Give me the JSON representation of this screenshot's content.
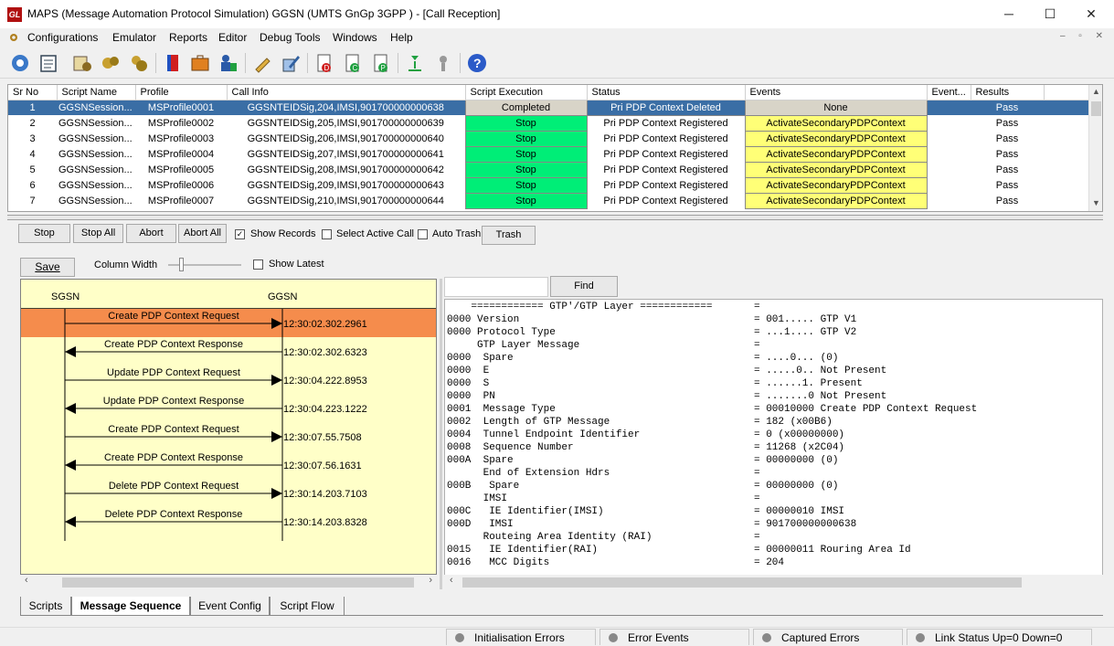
{
  "window": {
    "app_icon": "GL",
    "title": "MAPS (Message Automation Protocol Simulation) GGSN (UMTS GnGp 3GPP ) - [Call Reception]",
    "minimize": "─",
    "maximize": "☐",
    "close": "✕"
  },
  "menu": [
    "Configurations",
    "Emulator",
    "Reports",
    "Editor",
    "Debug Tools",
    "Windows",
    "Help"
  ],
  "toolbar_icons": [
    "settings-gear-icon",
    "notebook-icon",
    "profile-editor-icon",
    "script-tools-icon",
    "script-tools-2-icon",
    "phone-book-icon",
    "briefcase-icon",
    "user-db-icon",
    "pencil-icon",
    "batch-edit-icon",
    "doc-d-icon",
    "doc-c-icon",
    "doc-p-icon",
    "load-icon",
    "tools-icon",
    "help-icon"
  ],
  "grid": {
    "columns": [
      "Sr No",
      "Script Name",
      "Profile",
      "Call Info",
      "Script Execution",
      "Status",
      "Events",
      "Event...",
      "Results"
    ],
    "rows": [
      {
        "sr": "1",
        "script": "GGSNSession...",
        "profile": "MSProfile0001",
        "call_info": "GGSNTEIDSig,204,IMSI,901700000000638",
        "execution": "Completed",
        "status": "Pri PDP Context Deleted",
        "events": "None",
        "result": "Pass"
      },
      {
        "sr": "2",
        "script": "GGSNSession...",
        "profile": "MSProfile0002",
        "call_info": "GGSNTEIDSig,205,IMSI,901700000000639",
        "execution": "Stop",
        "status": "Pri PDP Context Registered",
        "events": "ActivateSecondaryPDPContext",
        "result": "Pass"
      },
      {
        "sr": "3",
        "script": "GGSNSession...",
        "profile": "MSProfile0003",
        "call_info": "GGSNTEIDSig,206,IMSI,901700000000640",
        "execution": "Stop",
        "status": "Pri PDP Context Registered",
        "events": "ActivateSecondaryPDPContext",
        "result": "Pass"
      },
      {
        "sr": "4",
        "script": "GGSNSession...",
        "profile": "MSProfile0004",
        "call_info": "GGSNTEIDSig,207,IMSI,901700000000641",
        "execution": "Stop",
        "status": "Pri PDP Context Registered",
        "events": "ActivateSecondaryPDPContext",
        "result": "Pass"
      },
      {
        "sr": "5",
        "script": "GGSNSession...",
        "profile": "MSProfile0005",
        "call_info": "GGSNTEIDSig,208,IMSI,901700000000642",
        "execution": "Stop",
        "status": "Pri PDP Context Registered",
        "events": "ActivateSecondaryPDPContext",
        "result": "Pass"
      },
      {
        "sr": "6",
        "script": "GGSNSession...",
        "profile": "MSProfile0006",
        "call_info": "GGSNTEIDSig,209,IMSI,901700000000643",
        "execution": "Stop",
        "status": "Pri PDP Context Registered",
        "events": "ActivateSecondaryPDPContext",
        "result": "Pass"
      },
      {
        "sr": "7",
        "script": "GGSNSession...",
        "profile": "MSProfile0007",
        "call_info": "GGSNTEIDSig,210,IMSI,901700000000644",
        "execution": "Stop",
        "status": "Pri PDP Context Registered",
        "events": "ActivateSecondaryPDPContext",
        "result": "Pass"
      }
    ]
  },
  "controls": {
    "stop": "Stop",
    "stop_all": "Stop All",
    "abort": "Abort",
    "abort_all": "Abort All",
    "show_records": "Show Records",
    "show_records_checked": "✓",
    "select_active_call": "Select Active Call",
    "auto_trash": "Auto Trash",
    "trash": "Trash",
    "save": "Save",
    "column_width": "Column Width",
    "show_latest": "Show Latest",
    "find": "Find",
    "find_value": ""
  },
  "ladder": {
    "left_node": "SGSN",
    "right_node": "GGSN",
    "messages": [
      {
        "label": "Create PDP Context Request",
        "time": "12:30:02.302.2961",
        "direction": "right",
        "selected": true
      },
      {
        "label": "Create PDP Context Response",
        "time": "12:30:02.302.6323",
        "direction": "left",
        "selected": false
      },
      {
        "label": "Update PDP Context Request",
        "time": "12:30:04.222.8953",
        "direction": "right",
        "selected": false
      },
      {
        "label": "Update PDP Context Response",
        "time": "12:30:04.223.1222",
        "direction": "left",
        "selected": false
      },
      {
        "label": "Create PDP Context Request",
        "time": "12:30:07.55.7508",
        "direction": "right",
        "selected": false
      },
      {
        "label": "Create PDP Context Response",
        "time": "12:30:07.56.1631",
        "direction": "left",
        "selected": false
      },
      {
        "label": "Delete PDP Context Request",
        "time": "12:30:14.203.7103",
        "direction": "right",
        "selected": false
      },
      {
        "label": "Delete PDP Context Response",
        "time": "12:30:14.203.8328",
        "direction": "left",
        "selected": false
      }
    ],
    "selected_color": "#f58c4c"
  },
  "decode": [
    {
      "left": "    ============ GTP'/GTP Layer ============",
      "right": "="
    },
    {
      "left": "0000 Version",
      "right": "= 001..... GTP V1"
    },
    {
      "left": "0000 Protocol Type",
      "right": "= ...1.... GTP V2"
    },
    {
      "left": "     GTP Layer Message",
      "right": "="
    },
    {
      "left": "0000  Spare",
      "right": "= ....0... (0)"
    },
    {
      "left": "0000  E",
      "right": "= .....0.. Not Present"
    },
    {
      "left": "0000  S",
      "right": "= ......1. Present"
    },
    {
      "left": "0000  PN",
      "right": "= .......0 Not Present"
    },
    {
      "left": "0001  Message Type",
      "right": "= 00010000 Create PDP Context Request"
    },
    {
      "left": "0002  Length of GTP Message",
      "right": "= 182 (x00B6)"
    },
    {
      "left": "0004  Tunnel Endpoint Identifier",
      "right": "= 0 (x00000000)"
    },
    {
      "left": "0008  Sequence Number",
      "right": "= 11268 (x2C04)"
    },
    {
      "left": "000A  Spare",
      "right": "= 00000000 (0)"
    },
    {
      "left": "      End of Extension Hdrs",
      "right": "="
    },
    {
      "left": "000B   Spare",
      "right": "= 00000000 (0)"
    },
    {
      "left": "      IMSI",
      "right": "="
    },
    {
      "left": "000C   IE Identifier(IMSI)",
      "right": "= 00000010 IMSI"
    },
    {
      "left": "000D   IMSI",
      "right": "= 901700000000638"
    },
    {
      "left": "      Routeing Area Identity (RAI)",
      "right": "="
    },
    {
      "left": "0015   IE Identifier(RAI)",
      "right": "= 00000011 Rouring Area Id"
    },
    {
      "left": "0016   MCC Digits",
      "right": "= 204"
    }
  ],
  "tabs": [
    "Scripts",
    "Message Sequence",
    "Event Config",
    "Script Flow"
  ],
  "active_tab": "Message Sequence",
  "status_bar": [
    "Initialisation Errors",
    "Error Events",
    "Captured Errors",
    "Link Status Up=0 Down=0"
  ],
  "colors": {
    "selected_row": "#3a6ea5",
    "stop_green": "#00ee77",
    "event_yellow": "#ffff77",
    "ladder_bg": "#ffffc8"
  }
}
